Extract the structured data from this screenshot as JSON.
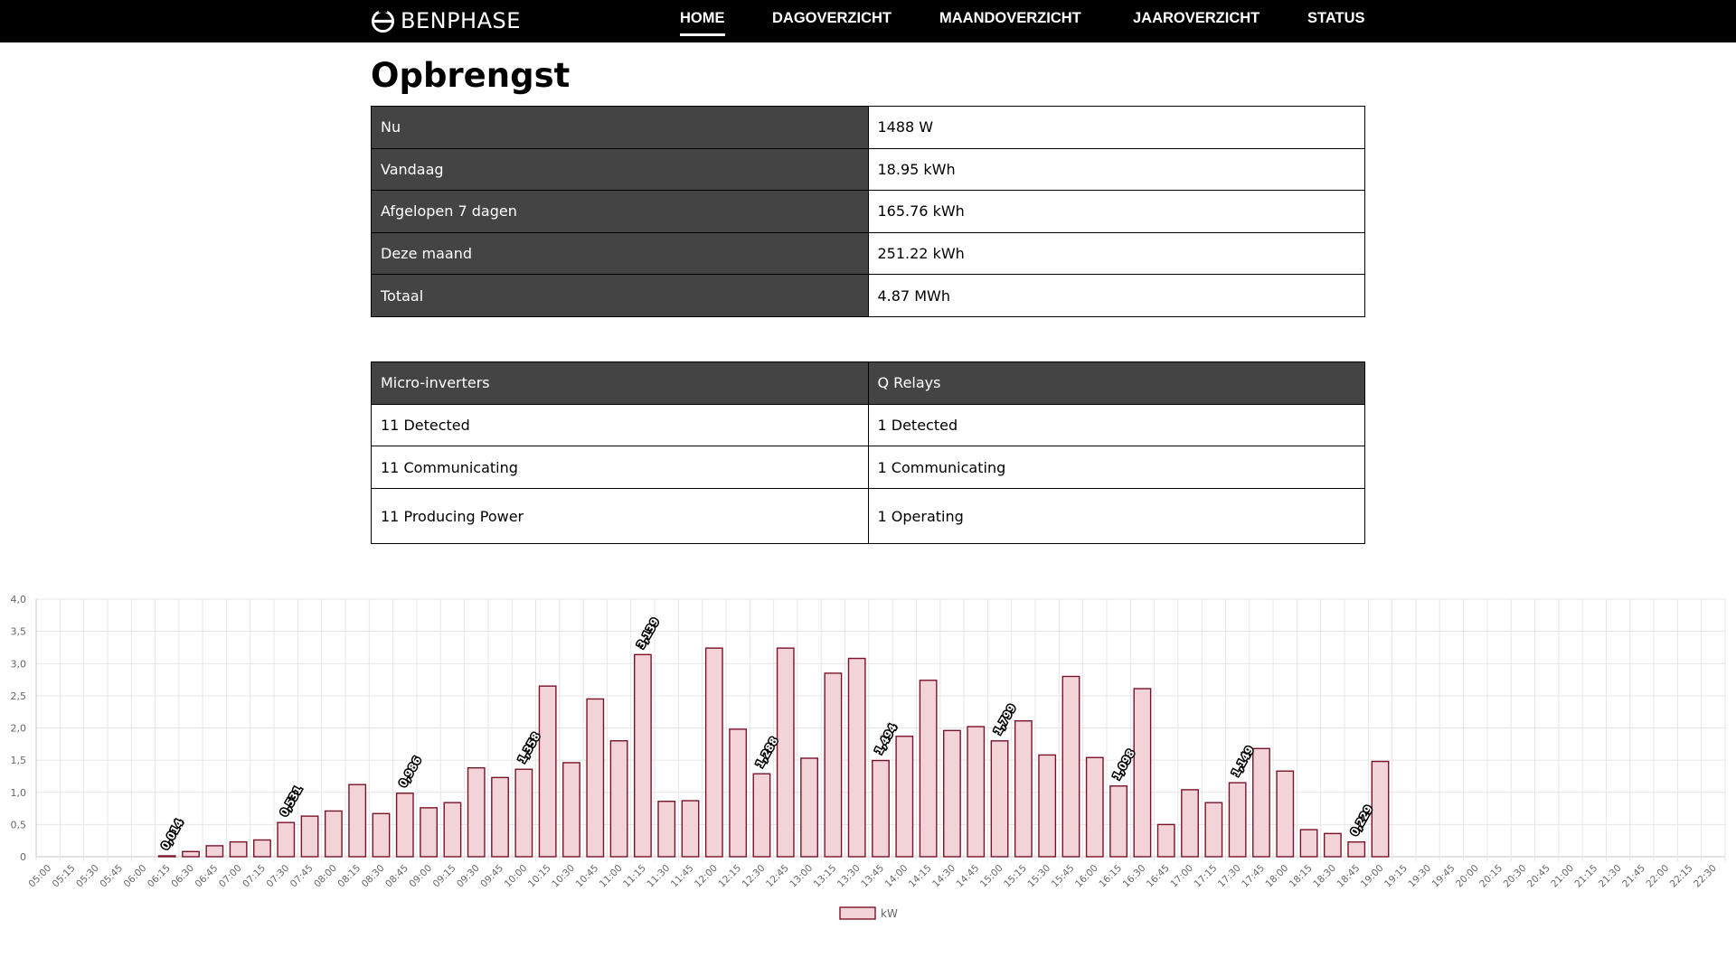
{
  "brand": {
    "name": "BENPHASE",
    "icon": "benphase-logo-icon"
  },
  "nav": [
    {
      "label": "HOME",
      "active": true
    },
    {
      "label": "DAGOVERZICHT",
      "active": false
    },
    {
      "label": "MAANDOVERZICHT",
      "active": false
    },
    {
      "label": "JAAROVERZICHT",
      "active": false
    },
    {
      "label": "STATUS",
      "active": false
    }
  ],
  "page": {
    "title": "Opbrengst"
  },
  "production": [
    {
      "label": "Nu",
      "value": "1488 W"
    },
    {
      "label": "Vandaag",
      "value": "18.95 kWh"
    },
    {
      "label": "Afgelopen 7 dagen",
      "value": "165.76 kWh"
    },
    {
      "label": "Deze maand",
      "value": "251.22 kWh"
    },
    {
      "label": "Totaal",
      "value": "4.87 MWh"
    }
  ],
  "devices": {
    "headers": [
      "Micro-inverters",
      "Q Relays"
    ],
    "rows": [
      [
        "11 Detected",
        "1 Detected"
      ],
      [
        "11 Communicating",
        "1 Communicating"
      ],
      [
        "11 Producing Power",
        "1 Operating"
      ]
    ]
  },
  "colors": {
    "nav_bg": "#000000",
    "table_dark": "#444444",
    "bar_fill": "#f2d3d8",
    "bar_stroke": "#7a1228"
  },
  "chart_data": {
    "type": "bar",
    "title": "",
    "xlabel": "",
    "ylabel": "",
    "ylim": [
      0,
      4.0
    ],
    "y_ticks": [
      "0",
      "0,5",
      "1,0",
      "1,5",
      "2,0",
      "2,5",
      "3,0",
      "3,5",
      "4,0"
    ],
    "grid": true,
    "legend": "bottom",
    "categories": [
      "05:00",
      "05:15",
      "05:30",
      "05:45",
      "06:00",
      "06:15",
      "06:30",
      "06:45",
      "07:00",
      "07:15",
      "07:30",
      "07:45",
      "08:00",
      "08:15",
      "08:30",
      "08:45",
      "09:00",
      "09:15",
      "09:30",
      "09:45",
      "10:00",
      "10:15",
      "10:30",
      "10:45",
      "11:00",
      "11:15",
      "11:30",
      "11:45",
      "12:00",
      "12:15",
      "12:30",
      "12:45",
      "13:00",
      "13:15",
      "13:30",
      "13:45",
      "14:00",
      "14:15",
      "14:30",
      "14:45",
      "15:00",
      "15:15",
      "15:30",
      "15:45",
      "16:00",
      "16:15",
      "16:30",
      "16:45",
      "17:00",
      "17:15",
      "17:30",
      "17:45",
      "18:00",
      "18:15",
      "18:30",
      "18:45",
      "19:00",
      "19:15",
      "19:30",
      "19:45",
      "20:00",
      "20:15",
      "20:30",
      "20:45",
      "21:00",
      "21:15",
      "21:30",
      "21:45",
      "22:00",
      "22:15",
      "22:30"
    ],
    "series": [
      {
        "name": "kW",
        "values": [
          null,
          null,
          null,
          null,
          null,
          0.014,
          0.08,
          0.17,
          0.23,
          0.26,
          0.531,
          0.63,
          0.71,
          1.12,
          0.67,
          0.986,
          0.76,
          0.84,
          1.38,
          1.23,
          1.358,
          2.65,
          1.46,
          2.45,
          1.8,
          3.139,
          0.86,
          0.87,
          3.24,
          1.98,
          1.288,
          3.24,
          1.53,
          2.85,
          3.08,
          1.494,
          1.87,
          2.74,
          1.96,
          2.02,
          1.799,
          2.11,
          1.58,
          2.8,
          1.54,
          1.098,
          2.61,
          0.5,
          1.04,
          0.84,
          1.149,
          1.68,
          1.33,
          0.42,
          0.36,
          0.229,
          1.48,
          null,
          null,
          null,
          null,
          null,
          null,
          null,
          null,
          null,
          null,
          null,
          null,
          null,
          null
        ]
      }
    ],
    "data_labels": [
      {
        "category": "06:15",
        "text": "0,014"
      },
      {
        "category": "07:30",
        "text": "0,531"
      },
      {
        "category": "08:45",
        "text": "0,986"
      },
      {
        "category": "10:00",
        "text": "1,358"
      },
      {
        "category": "11:15",
        "text": "3,139"
      },
      {
        "category": "12:30",
        "text": "1,288"
      },
      {
        "category": "13:45",
        "text": "1,494"
      },
      {
        "category": "15:00",
        "text": "1,799"
      },
      {
        "category": "16:15",
        "text": "1,098"
      },
      {
        "category": "17:30",
        "text": "1,149"
      },
      {
        "category": "18:45",
        "text": "0,229"
      }
    ]
  }
}
